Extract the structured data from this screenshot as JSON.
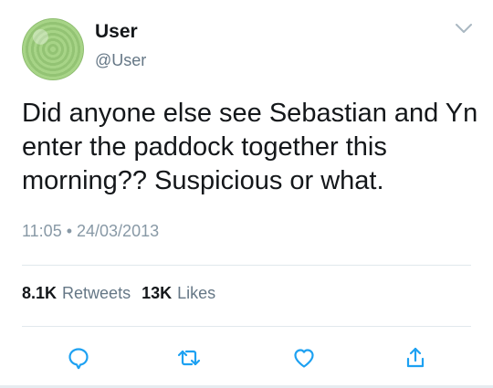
{
  "author": {
    "name": "User",
    "handle": "@User",
    "avatar_icon": "knitted-green-avatar"
  },
  "tweet": {
    "text": "Did anyone else see Sebastian and Yn enter the paddock together this morning?? Suspicious or what.",
    "timestamp": "11:05 • 24/03/2013"
  },
  "stats": {
    "retweets_count": "8.1K",
    "retweets_label": "Retweets",
    "likes_count": "13K",
    "likes_label": "Likes"
  },
  "actions": {
    "reply_icon": "reply-icon",
    "retweet_icon": "retweet-icon",
    "like_icon": "heart-icon",
    "share_icon": "share-icon"
  },
  "colors": {
    "text_primary": "#14171a",
    "text_secondary": "#657786",
    "icon_color": "#1da1f2",
    "divider": "#e1e8ed"
  }
}
